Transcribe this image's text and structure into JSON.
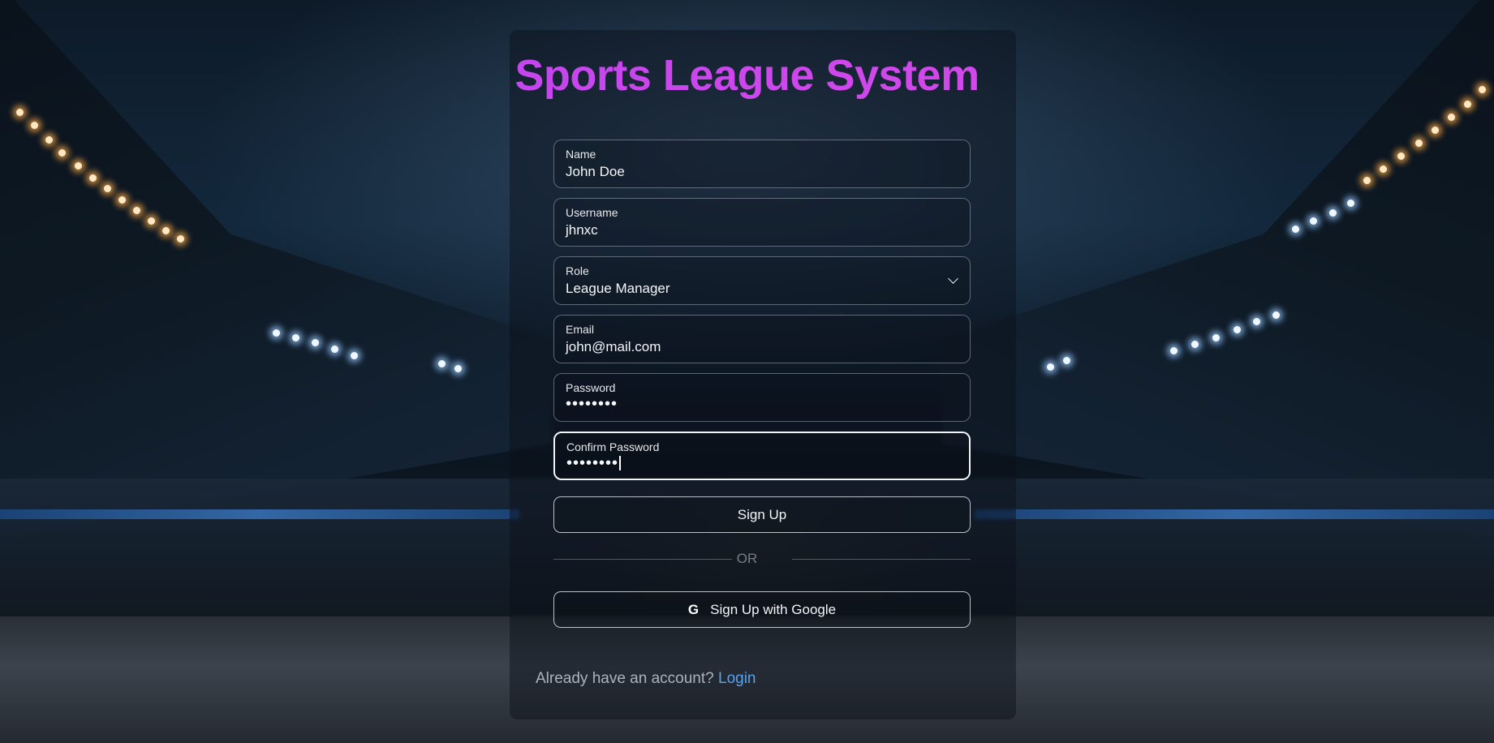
{
  "page": {
    "title": "Sports League System"
  },
  "form": {
    "name": {
      "label": "Name",
      "value": "John Doe"
    },
    "username": {
      "label": "Username",
      "value": "jhnxc"
    },
    "role": {
      "label": "Role",
      "value": "League Manager"
    },
    "email": {
      "label": "Email",
      "value": "john@mail.com"
    },
    "password": {
      "label": "Password",
      "value": "••••••••"
    },
    "confirm_password": {
      "label": "Confirm Password",
      "value": "••••••••"
    }
  },
  "actions": {
    "signup_label": "Sign Up",
    "divider_text": "OR",
    "google_label": "Sign Up with Google",
    "google_icon": "G"
  },
  "footer": {
    "prompt": "Already have an account?",
    "login_link": "Login"
  },
  "colors": {
    "title_gradient_start": "#b744f2",
    "title_gradient_end": "#e04ae6",
    "link": "#5aa2ee"
  }
}
